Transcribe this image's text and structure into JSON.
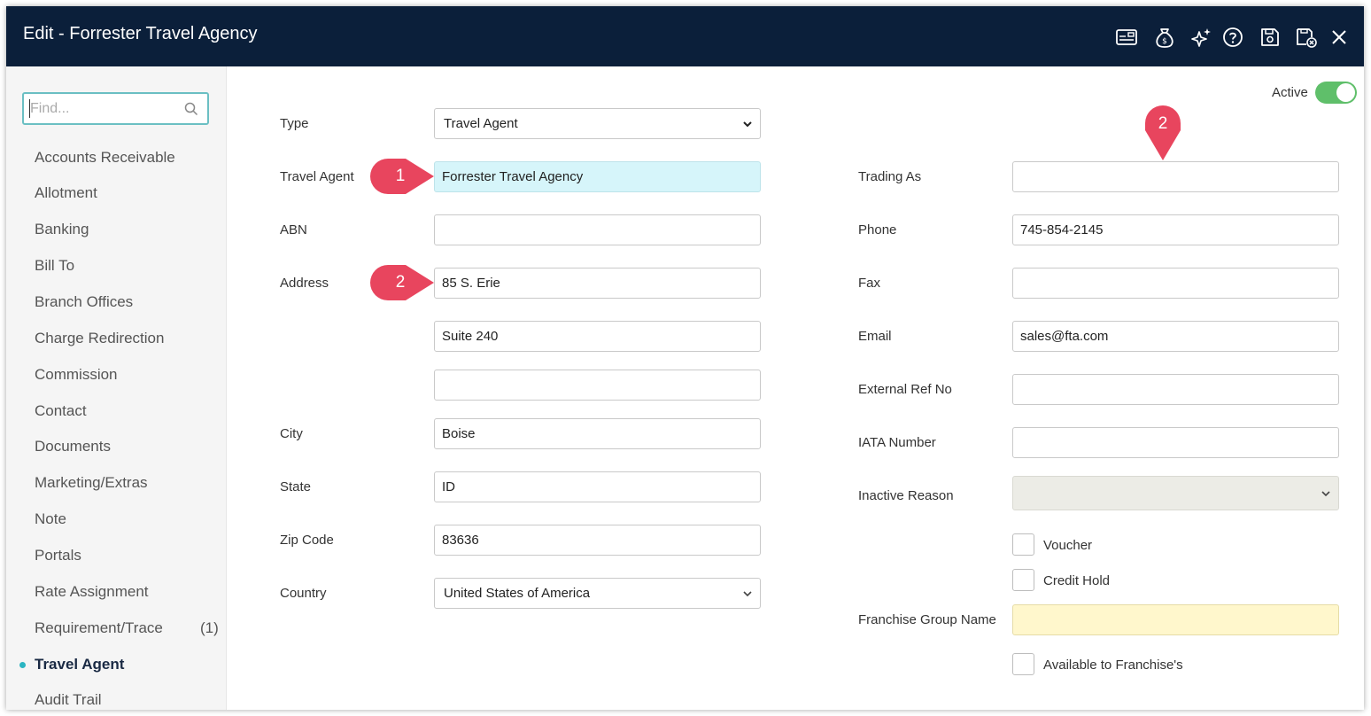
{
  "window": {
    "title": "Edit - Forrester Travel Agency",
    "toolbar_icons": [
      "card-icon",
      "money-bag-icon",
      "sparkle-icon",
      "help-icon",
      "save-icon",
      "save-close-icon",
      "close-icon"
    ]
  },
  "sidebar": {
    "search_placeholder": "Find...",
    "items": [
      {
        "label": "Accounts Receivable"
      },
      {
        "label": "Allotment"
      },
      {
        "label": "Banking"
      },
      {
        "label": "Bill To"
      },
      {
        "label": "Branch Offices"
      },
      {
        "label": "Charge Redirection"
      },
      {
        "label": "Commission"
      },
      {
        "label": "Contact"
      },
      {
        "label": "Documents"
      },
      {
        "label": "Marketing/Extras"
      },
      {
        "label": "Note"
      },
      {
        "label": "Portals"
      },
      {
        "label": "Rate Assignment"
      },
      {
        "label": "Requirement/Trace",
        "count": "(1)"
      },
      {
        "label": "Travel Agent",
        "active": true
      },
      {
        "label": "Audit Trail"
      }
    ]
  },
  "form": {
    "active_label": "Active",
    "active": true,
    "type": {
      "label": "Type",
      "value": "Travel Agent"
    },
    "travel_agent": {
      "label": "Travel Agent",
      "value": "Forrester Travel Agency"
    },
    "abn": {
      "label": "ABN",
      "value": ""
    },
    "address": {
      "label": "Address",
      "line1": "85 S. Erie",
      "line2": "Suite 240",
      "line3": ""
    },
    "city": {
      "label": "City",
      "value": "Boise"
    },
    "state": {
      "label": "State",
      "value": "ID"
    },
    "zip": {
      "label": "Zip Code",
      "value": "83636"
    },
    "country": {
      "label": "Country",
      "value": "United States of America"
    },
    "trading_as": {
      "label": "Trading As",
      "value": ""
    },
    "phone": {
      "label": "Phone",
      "value": "745-854-2145"
    },
    "fax": {
      "label": "Fax",
      "value": ""
    },
    "email": {
      "label": "Email",
      "value": "sales@fta.com"
    },
    "external_ref": {
      "label": "External Ref No",
      "value": ""
    },
    "iata": {
      "label": "IATA Number",
      "value": ""
    },
    "inactive_reason": {
      "label": "Inactive Reason",
      "value": ""
    },
    "voucher": {
      "label": "Voucher",
      "checked": false
    },
    "credit_hold": {
      "label": "Credit Hold",
      "checked": false
    },
    "franchise_group": {
      "label": "Franchise Group Name",
      "value": ""
    },
    "available_franchise": {
      "label": "Available to Franchise's",
      "checked": false
    }
  },
  "markers": {
    "one": "1",
    "two_address": "2",
    "two_trading": "2",
    "color": "#e8455e"
  },
  "colors": {
    "titlebar": "#0b1f3a",
    "accent": "#2bb5c2",
    "toggle_on": "#5fbf6a"
  }
}
